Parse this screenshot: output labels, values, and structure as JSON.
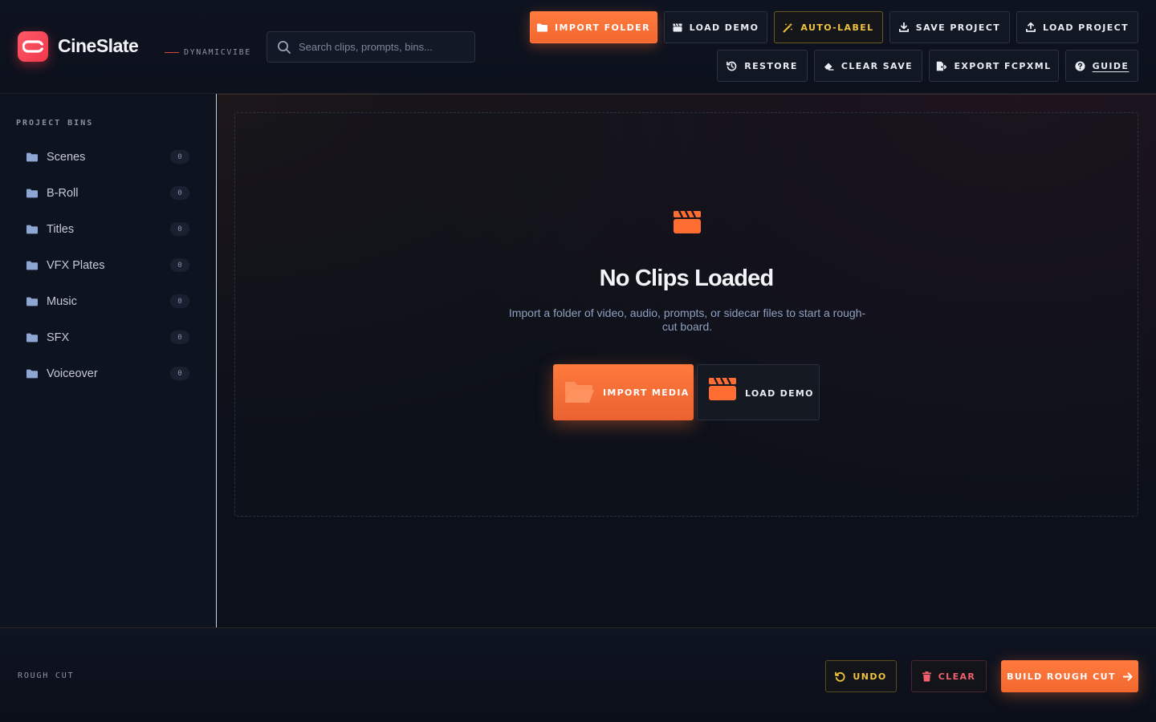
{
  "app": {
    "name": "CineSlate",
    "subtitle": "DYNAMICVIBE"
  },
  "search": {
    "placeholder": "Search clips, prompts, bins..."
  },
  "toolbar": {
    "import_folder": "IMPORT FOLDER",
    "load_demo": "LOAD DEMO",
    "auto_label": "AUTO-LABEL",
    "save_project": "SAVE PROJECT",
    "load_project": "LOAD PROJECT",
    "restore": "RESTORE",
    "clear_save": "CLEAR SAVE",
    "export_fcpxml": "EXPORT FCPXML",
    "guide": "GUIDE"
  },
  "sidebar": {
    "title": "PROJECT BINS",
    "bins": [
      {
        "label": "Scenes",
        "count": "0"
      },
      {
        "label": "B-Roll",
        "count": "0"
      },
      {
        "label": "Titles",
        "count": "0"
      },
      {
        "label": "VFX Plates",
        "count": "0"
      },
      {
        "label": "Music",
        "count": "0"
      },
      {
        "label": "SFX",
        "count": "0"
      },
      {
        "label": "Voiceover",
        "count": "0"
      }
    ]
  },
  "empty_state": {
    "title": "No Clips Loaded",
    "description": "Import a folder of video, audio, prompts, or sidecar files to start a rough-cut board.",
    "import_media": "IMPORT MEDIA",
    "load_demo": "LOAD DEMO"
  },
  "footer": {
    "label": "ROUGH CUT",
    "undo": "UNDO",
    "clear": "CLEAR",
    "build": "BUILD ROUGH CUT"
  },
  "colors": {
    "accent": "#ff7a3d",
    "brand": "#f0384a",
    "warning": "#f0c33c",
    "danger": "#f0606a",
    "background": "#0b0f19"
  }
}
